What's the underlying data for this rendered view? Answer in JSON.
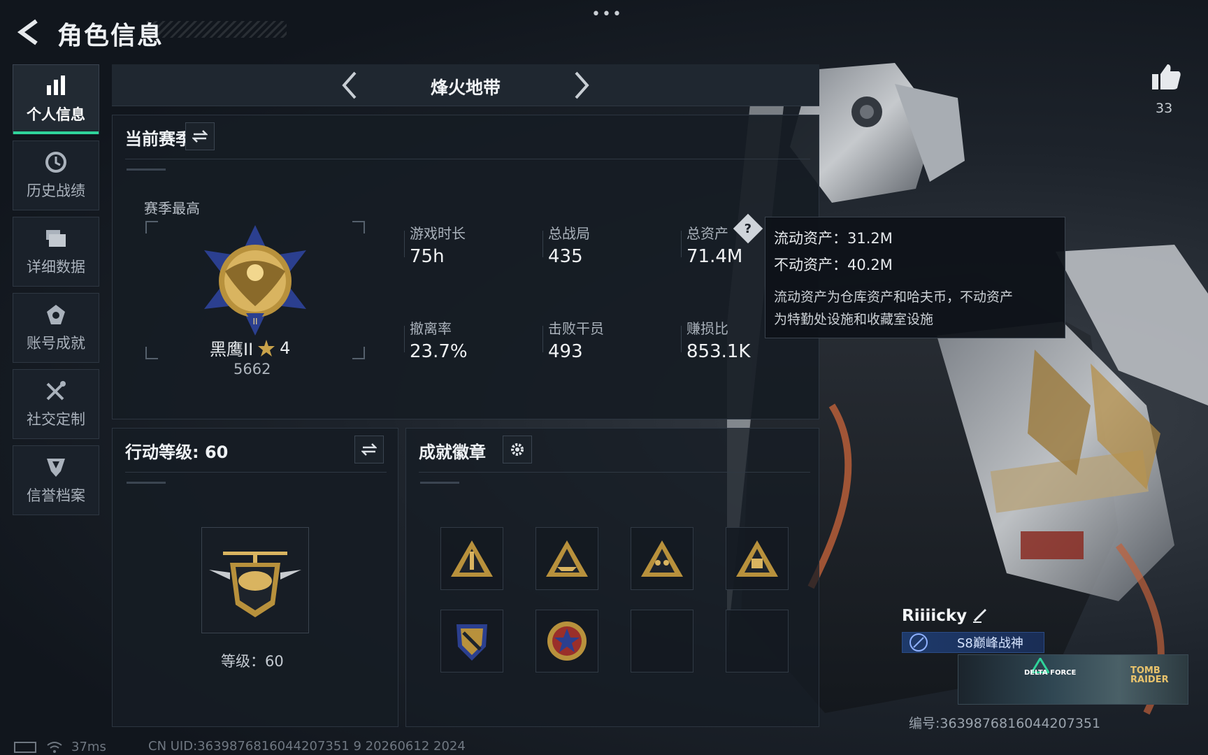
{
  "header": {
    "title": "角色信息",
    "more_dots": "•••"
  },
  "sidebar": {
    "items": [
      {
        "label": "个人信息",
        "icon": "bar-chart-icon",
        "active": true
      },
      {
        "label": "历史战绩",
        "icon": "history-clock-icon",
        "active": false
      },
      {
        "label": "详细数据",
        "icon": "folder-icon",
        "active": false
      },
      {
        "label": "账号成就",
        "icon": "achievement-icon",
        "active": false
      },
      {
        "label": "社交定制",
        "icon": "tools-icon",
        "active": false
      },
      {
        "label": "信誉档案",
        "icon": "credit-shield-icon",
        "active": false
      }
    ]
  },
  "mode": {
    "title": "烽火地带"
  },
  "season": {
    "heading": "当前赛季",
    "best_label": "赛季最高",
    "rank_name": "黑鹰II",
    "rank_stars": "4",
    "rank_score": "5662",
    "stats": [
      {
        "label": "游戏时长",
        "value": "75h"
      },
      {
        "label": "总战局",
        "value": "435"
      },
      {
        "label": "总资产",
        "value": "71.4M"
      },
      {
        "label": "撤离率",
        "value": "23.7%"
      },
      {
        "label": "击败干员",
        "value": "493"
      },
      {
        "label": "赚损比",
        "value": "853.1K"
      }
    ]
  },
  "tooltip": {
    "liquid": "流动资产：31.2M",
    "fixed": "不动资产：40.2M",
    "desc_line1": "流动资产为仓库资产和哈夫币，不动资产",
    "desc_line2": "为特勤处设施和收藏室设施"
  },
  "likes": {
    "count": "33"
  },
  "level": {
    "heading": "行动等级: 60",
    "level_text": "等级：60"
  },
  "badges": {
    "heading": "成就徽章",
    "items": [
      "rocket-badge-icon",
      "ship-badge-icon",
      "squad-badge-icon",
      "map58-badge-icon",
      "shield-emblem-badge-icon",
      "star-medal-badge-icon",
      "",
      ""
    ]
  },
  "profile": {
    "name": "Riiiicky",
    "title_tag": "S8巅峰战神",
    "banner_text_1": "DELTA FORCE",
    "banner_text_2a": "TOMB",
    "banner_text_2b": "RAIDER",
    "serial": "编号:3639876816044207351"
  },
  "status_bar": {
    "ping": "37ms",
    "uid": "CN UID:3639876816044207351 9  20260612 2024"
  },
  "colors": {
    "accent_green": "#2fd39a",
    "gold": "#c9a24a",
    "background": "#121820"
  }
}
